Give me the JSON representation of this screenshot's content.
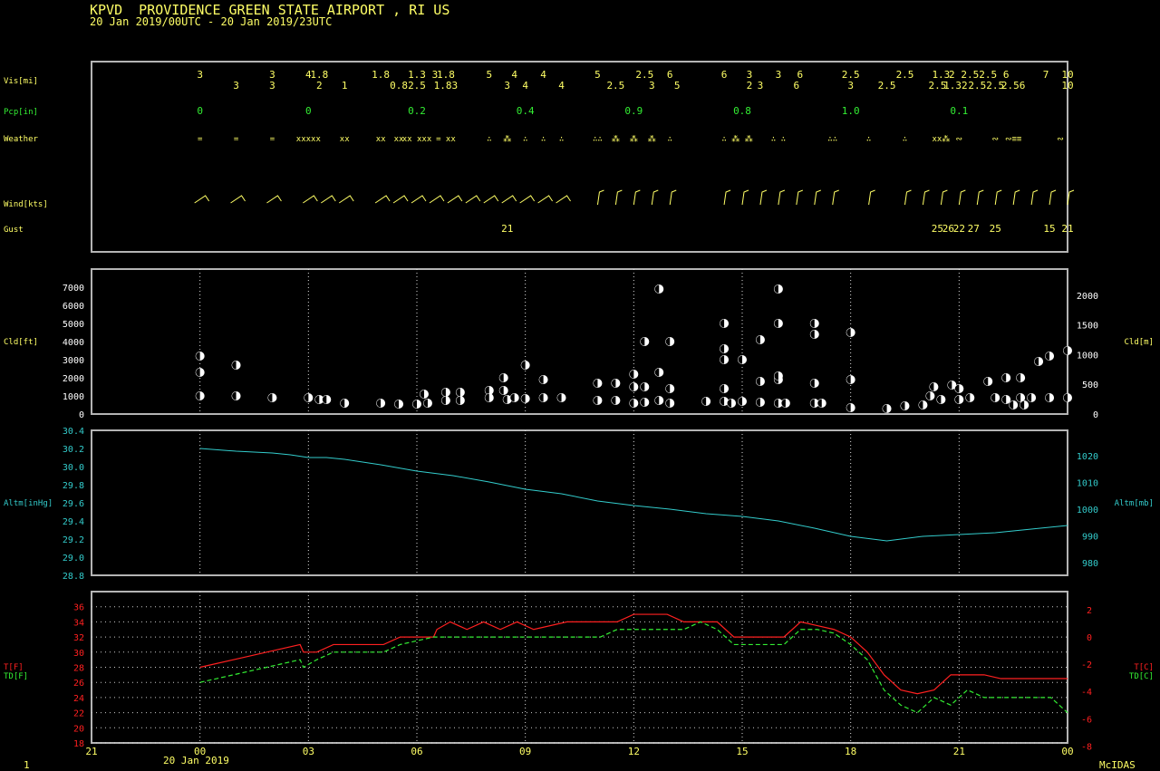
{
  "header": {
    "title": "KPVD  PROVIDENCE GREEN STATE AIRPORT , RI US",
    "subtitle": "20 Jan 2019/00UTC - 20 Jan 2019/23UTC"
  },
  "footer": {
    "frame": "1",
    "date": "20 Jan 2019",
    "brand": "McIDAS"
  },
  "colors": {
    "frame": "#b4b4b4",
    "text": "#ffff66",
    "green": "#33ee33",
    "cyan": "#33cccc",
    "red": "#ff2020",
    "white": "#ffffff"
  },
  "xaxis": {
    "ticks": [
      "21",
      "00",
      "03",
      "06",
      "09",
      "12",
      "15",
      "18",
      "21",
      "00"
    ],
    "range_hours": [
      -3,
      24
    ]
  },
  "panel_labels": {
    "vis": "Vis[mi]",
    "pcp": "Pcp[in]",
    "weather": "Weather",
    "wind": "Wind[kts]",
    "gust": "Gust",
    "cld_left": "Cld[ft]",
    "cld_right": "Cld[m]",
    "altm_left": "Altm[inHg]",
    "altm_right": "Altm[mb]",
    "t_left": "T[F]",
    "td_left": "TD[F]",
    "t_right": "T[C]",
    "td_right": "TD[C]"
  },
  "chart_data": [
    {
      "type": "table",
      "name": "Vis/Pcp/Weather/Wind/Gust",
      "vis_top": [
        [
          0,
          "3"
        ],
        [
          2,
          "3"
        ],
        [
          3,
          "4"
        ],
        [
          3.3,
          "1.8"
        ],
        [
          5,
          "1.8"
        ],
        [
          6,
          "1.3"
        ],
        [
          6.5,
          "3"
        ],
        [
          6.8,
          "1.8"
        ],
        [
          8,
          "5"
        ],
        [
          8.7,
          "4"
        ],
        [
          9.5,
          "4"
        ],
        [
          11,
          "5"
        ],
        [
          12.3,
          "2.5"
        ],
        [
          13,
          "6"
        ],
        [
          14.5,
          "6"
        ],
        [
          15.2,
          "3"
        ],
        [
          16,
          "3"
        ],
        [
          16.6,
          "6"
        ],
        [
          18,
          "2.5"
        ],
        [
          19.5,
          "2.5"
        ],
        [
          20.5,
          "1.3"
        ],
        [
          20.8,
          "2"
        ],
        [
          21.3,
          "2.5"
        ],
        [
          21.8,
          "2.5"
        ],
        [
          22.3,
          "6"
        ],
        [
          23.4,
          "7"
        ],
        [
          24,
          "10"
        ]
      ],
      "vis_bottom": [
        [
          1,
          "3"
        ],
        [
          2,
          "3"
        ],
        [
          3.3,
          "2"
        ],
        [
          4,
          "1"
        ],
        [
          5.5,
          "0.8"
        ],
        [
          6,
          "2.5"
        ],
        [
          6.8,
          "1.83"
        ],
        [
          8.5,
          "3"
        ],
        [
          9,
          "4"
        ],
        [
          10,
          "4"
        ],
        [
          11.5,
          "2.5"
        ],
        [
          12.5,
          "3"
        ],
        [
          13.2,
          "5"
        ],
        [
          15.2,
          "2"
        ],
        [
          15.5,
          "3"
        ],
        [
          16.5,
          "6"
        ],
        [
          18,
          "3"
        ],
        [
          19,
          "2.5"
        ],
        [
          20.4,
          "2.5"
        ],
        [
          20.9,
          "1.32"
        ],
        [
          21.5,
          "2.5"
        ],
        [
          22,
          "2.5"
        ],
        [
          22.5,
          "2.56"
        ],
        [
          24,
          "10"
        ]
      ],
      "pcp": [
        [
          0,
          "0"
        ],
        [
          3,
          "0"
        ],
        [
          6,
          "0.2"
        ],
        [
          9,
          "0.4"
        ],
        [
          12,
          "0.9"
        ],
        [
          15,
          "0.8"
        ],
        [
          18,
          "1.0"
        ],
        [
          21,
          "0.1"
        ]
      ],
      "weather": [
        [
          0,
          "="
        ],
        [
          1,
          "="
        ],
        [
          2,
          "="
        ],
        [
          3,
          "xxxxx"
        ],
        [
          4,
          "xx"
        ],
        [
          5,
          "xx"
        ],
        [
          5.5,
          "xx"
        ],
        [
          6,
          "xx xxx"
        ],
        [
          6.8,
          "= xx"
        ],
        [
          8,
          "∴"
        ],
        [
          8.5,
          "⁂"
        ],
        [
          9,
          "∴"
        ],
        [
          9.5,
          "∴"
        ],
        [
          10,
          "∴"
        ],
        [
          11,
          "∴∴"
        ],
        [
          11.5,
          "⁂"
        ],
        [
          12,
          "⁂"
        ],
        [
          12.5,
          "⁂"
        ],
        [
          13,
          "∴"
        ],
        [
          14.5,
          "∴"
        ],
        [
          15,
          "⁂ ⁂"
        ],
        [
          16,
          "∴ ∴"
        ],
        [
          17.5,
          "∴∴"
        ],
        [
          18.5,
          "∴"
        ],
        [
          19.5,
          "∴"
        ],
        [
          20.5,
          "xx⁂"
        ],
        [
          21,
          "∾"
        ],
        [
          22,
          "∾"
        ],
        [
          22.5,
          "∾≡≡"
        ],
        [
          23.8,
          "∾"
        ]
      ],
      "wind": [
        0,
        1,
        2,
        3,
        3.5,
        4,
        5,
        5.5,
        6,
        6.5,
        7,
        7.5,
        8,
        8.5,
        9,
        9.5,
        10,
        11,
        11.5,
        12,
        12.5,
        13,
        14.5,
        15,
        15.5,
        16,
        16.5,
        17,
        17.5,
        18.5,
        19.5,
        20,
        20.5,
        21,
        21.5,
        22,
        22.5,
        23,
        23.5,
        24
      ],
      "gust": [
        [
          8.5,
          "21"
        ],
        [
          20.4,
          "25"
        ],
        [
          20.7,
          "26"
        ],
        [
          21,
          "22"
        ],
        [
          21.4,
          "27"
        ],
        [
          22,
          "25"
        ],
        [
          23.5,
          "15"
        ],
        [
          24,
          "21"
        ]
      ]
    },
    {
      "type": "scatter",
      "name": "Cloud base",
      "ylabel_left": "Cld[ft]",
      "ylabel_right": "Cld[m]",
      "ylim": [
        0,
        8000
      ],
      "left_ticks": [
        "0",
        "1000",
        "2000",
        "3000",
        "4000",
        "5000",
        "6000",
        "7000"
      ],
      "right_ticks": [
        "0",
        "500",
        "1000",
        "1500",
        "2000"
      ],
      "points": [
        [
          0,
          3200
        ],
        [
          0,
          2300
        ],
        [
          0,
          1000
        ],
        [
          1,
          2700
        ],
        [
          1,
          1000
        ],
        [
          2,
          900
        ],
        [
          3,
          900
        ],
        [
          3.3,
          800
        ],
        [
          3.5,
          800
        ],
        [
          4,
          600
        ],
        [
          5,
          600
        ],
        [
          5.5,
          550
        ],
        [
          6,
          550
        ],
        [
          6.2,
          1100
        ],
        [
          6.3,
          600
        ],
        [
          6.8,
          1200
        ],
        [
          6.8,
          750
        ],
        [
          7.2,
          1200
        ],
        [
          7.2,
          750
        ],
        [
          8,
          1300
        ],
        [
          8,
          900
        ],
        [
          8.4,
          2000
        ],
        [
          8.4,
          1300
        ],
        [
          8.5,
          800
        ],
        [
          8.7,
          900
        ],
        [
          9,
          850
        ],
        [
          9,
          2700
        ],
        [
          9.5,
          900
        ],
        [
          9.5,
          1900
        ],
        [
          10,
          900
        ],
        [
          11,
          1700
        ],
        [
          11,
          750
        ],
        [
          11.5,
          1700
        ],
        [
          11.5,
          750
        ],
        [
          12,
          1500
        ],
        [
          12,
          2200
        ],
        [
          12,
          600
        ],
        [
          12.3,
          4000
        ],
        [
          12.3,
          1500
        ],
        [
          12.3,
          650
        ],
        [
          12.7,
          2300
        ],
        [
          12.7,
          6900
        ],
        [
          12.7,
          750
        ],
        [
          13,
          4000
        ],
        [
          13,
          1400
        ],
        [
          13,
          600
        ],
        [
          14,
          700
        ],
        [
          14.5,
          5000
        ],
        [
          14.5,
          3600
        ],
        [
          14.5,
          3000
        ],
        [
          14.5,
          1400
        ],
        [
          14.5,
          700
        ],
        [
          14.7,
          600
        ],
        [
          15,
          3000
        ],
        [
          15,
          700
        ],
        [
          15.5,
          4100
        ],
        [
          15.5,
          1800
        ],
        [
          15.5,
          650
        ],
        [
          16,
          6900
        ],
        [
          16,
          5000
        ],
        [
          16,
          1900
        ],
        [
          16,
          2100
        ],
        [
          16,
          600
        ],
        [
          16.2,
          600
        ],
        [
          17,
          5000
        ],
        [
          17,
          4400
        ],
        [
          17,
          1700
        ],
        [
          17,
          600
        ],
        [
          17.2,
          600
        ],
        [
          18,
          4500
        ],
        [
          18,
          1900
        ],
        [
          18,
          350
        ],
        [
          19,
          300
        ],
        [
          19.5,
          450
        ],
        [
          20,
          500
        ],
        [
          20.2,
          1000
        ],
        [
          20.3,
          1500
        ],
        [
          20.5,
          800
        ],
        [
          20.8,
          1600
        ],
        [
          21,
          1400
        ],
        [
          21,
          800
        ],
        [
          21.3,
          900
        ],
        [
          21.8,
          1800
        ],
        [
          22,
          900
        ],
        [
          22.3,
          2000
        ],
        [
          22.3,
          800
        ],
        [
          22.5,
          500
        ],
        [
          22.7,
          2000
        ],
        [
          22.7,
          900
        ],
        [
          22.8,
          500
        ],
        [
          23,
          900
        ],
        [
          23.2,
          2900
        ],
        [
          23.5,
          3200
        ],
        [
          23.5,
          900
        ],
        [
          24,
          3500
        ],
        [
          24,
          900
        ],
        [
          24.2,
          1000
        ],
        [
          24.5,
          3500
        ],
        [
          24.5,
          3500
        ],
        [
          25,
          1400
        ],
        [
          25,
          3500
        ]
      ]
    },
    {
      "type": "line",
      "name": "Altimeter",
      "ylabel_left": "Altm[inHg]",
      "ylabel_right": "Altm[mb]",
      "ylim": [
        28.8,
        30.4
      ],
      "left_ticks": [
        "28.8",
        "29.0",
        "29.2",
        "29.4",
        "29.6",
        "29.8",
        "30.0",
        "30.2",
        "30.4"
      ],
      "right_ticks": [
        "980",
        "990",
        "1000",
        "1010",
        "1020"
      ],
      "x": [
        0,
        1,
        2,
        2.5,
        3,
        3.5,
        4,
        5,
        6,
        7,
        8,
        9,
        10,
        11,
        12,
        13,
        14,
        15,
        16,
        17,
        18,
        19,
        20,
        21,
        22,
        23,
        24
      ],
      "values": [
        30.2,
        30.17,
        30.15,
        30.13,
        30.1,
        30.1,
        30.08,
        30.02,
        29.95,
        29.9,
        29.83,
        29.75,
        29.7,
        29.62,
        29.57,
        29.53,
        29.48,
        29.45,
        29.4,
        29.32,
        29.23,
        29.18,
        29.23,
        29.25,
        29.27,
        29.31,
        29.35
      ]
    },
    {
      "type": "line",
      "name": "Temperature/Dewpoint",
      "ylabel_left": "T[F]",
      "ylabel_right": "T[C]",
      "ylim": [
        18,
        38
      ],
      "left_ticks": [
        "18",
        "20",
        "22",
        "24",
        "26",
        "28",
        "30",
        "32",
        "34",
        "36"
      ],
      "right_ticks": [
        "-8",
        "-6",
        "-4",
        "-2",
        "0",
        "2"
      ],
      "x": [
        0,
        1,
        2,
        3,
        3.1,
        3.5,
        4,
        5,
        5.5,
        6,
        7,
        7.1,
        7.5,
        8,
        8.5,
        9,
        9.5,
        10,
        11,
        11.5,
        12,
        12.5,
        13,
        14,
        14.5,
        15,
        15.5,
        16,
        17,
        17.5,
        18,
        18.5,
        19,
        19.5,
        20,
        20.5,
        21,
        21.5,
        22,
        22.5,
        23,
        23.5,
        24,
        24.5,
        25,
        25.5,
        26
      ],
      "series": [
        {
          "name": "T[F]",
          "values": [
            28,
            29,
            30,
            31,
            30,
            30,
            31,
            31,
            31,
            32,
            32,
            33,
            34,
            33,
            34,
            33,
            34,
            33,
            34,
            34,
            34,
            34,
            35,
            35,
            34,
            34,
            34,
            32,
            32,
            32,
            34,
            33.5,
            33,
            32,
            30,
            27,
            25,
            24.5,
            25,
            27,
            27,
            27,
            26.5,
            26.5,
            26.5,
            26.5,
            26.5
          ]
        },
        {
          "name": "TD[F]",
          "values": [
            26,
            27,
            28,
            29,
            28,
            29,
            30,
            30,
            30,
            31,
            32,
            32,
            32,
            32,
            32,
            32,
            32,
            32,
            32,
            32,
            32,
            33,
            33,
            33,
            33,
            34,
            33,
            31,
            31,
            31,
            33,
            33,
            32.5,
            31,
            29,
            25,
            23,
            22,
            24,
            23,
            25,
            24,
            24,
            24,
            24,
            24,
            22
          ]
        }
      ]
    }
  ]
}
